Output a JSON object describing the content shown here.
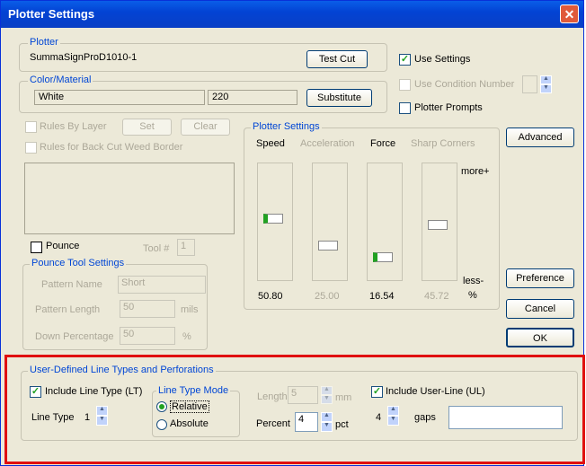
{
  "window": {
    "title": "Plotter Settings",
    "close": "✕"
  },
  "plotter": {
    "group_title": "Plotter",
    "name": "SummaSignProD1010-1",
    "test_cut": "Test Cut"
  },
  "color": {
    "group_title": "Color/Material",
    "name": "White",
    "value": "220",
    "substitute": "Substitute"
  },
  "options": {
    "use_settings": "Use Settings",
    "use_condition_number": "Use Condition Number",
    "plotter_prompts": "Plotter Prompts"
  },
  "rules": {
    "by_layer": "Rules By Layer",
    "set": "Set",
    "clear": "Clear",
    "back_cut": "Rules for Back Cut Weed Border"
  },
  "pounce": {
    "label": "Pounce",
    "tool_label": "Tool #",
    "tool_value": "1"
  },
  "pounce_tool": {
    "group_title": "Pounce Tool Settings",
    "pattern_name_label": "Pattern Name",
    "pattern_name_value": "Short",
    "pattern_length_label": "Pattern Length",
    "pattern_length_value": "50",
    "pattern_length_unit": "mils",
    "down_percentage_label": "Down Percentage",
    "down_percentage_value": "50",
    "down_percentage_unit": "%"
  },
  "plotter_settings": {
    "group_title": "Plotter Settings",
    "sliders": [
      {
        "label": "Speed",
        "value": "50.80",
        "level": 0.53
      },
      {
        "label": "Acceleration",
        "value": "25.00",
        "level": 0.28
      },
      {
        "label": "Force",
        "value": "16.54",
        "level": 0.17
      },
      {
        "label": "Sharp Corners",
        "value": "45.72",
        "level": 0.47
      }
    ],
    "more": "more+",
    "less": "less-",
    "percent": "%"
  },
  "buttons": {
    "advanced": "Advanced",
    "preference": "Preference",
    "cancel": "Cancel",
    "ok": "OK"
  },
  "line_types": {
    "group_title": "User-Defined Line Types and Perforations",
    "include_lt": "Include Line Type (LT)",
    "line_type_label": "Line Type",
    "line_type_value": "1",
    "mode_title": "Line Type Mode",
    "relative": "Relative",
    "absolute": "Absolute",
    "length_label": "Length",
    "length_value": "5",
    "length_unit": "mm",
    "percent_label": "Percent",
    "percent_value": "4",
    "percent_unit": "pct",
    "include_ul": "Include User-Line (UL)",
    "gaps_value": "4",
    "gaps_label": "gaps",
    "gaps_input": ""
  }
}
